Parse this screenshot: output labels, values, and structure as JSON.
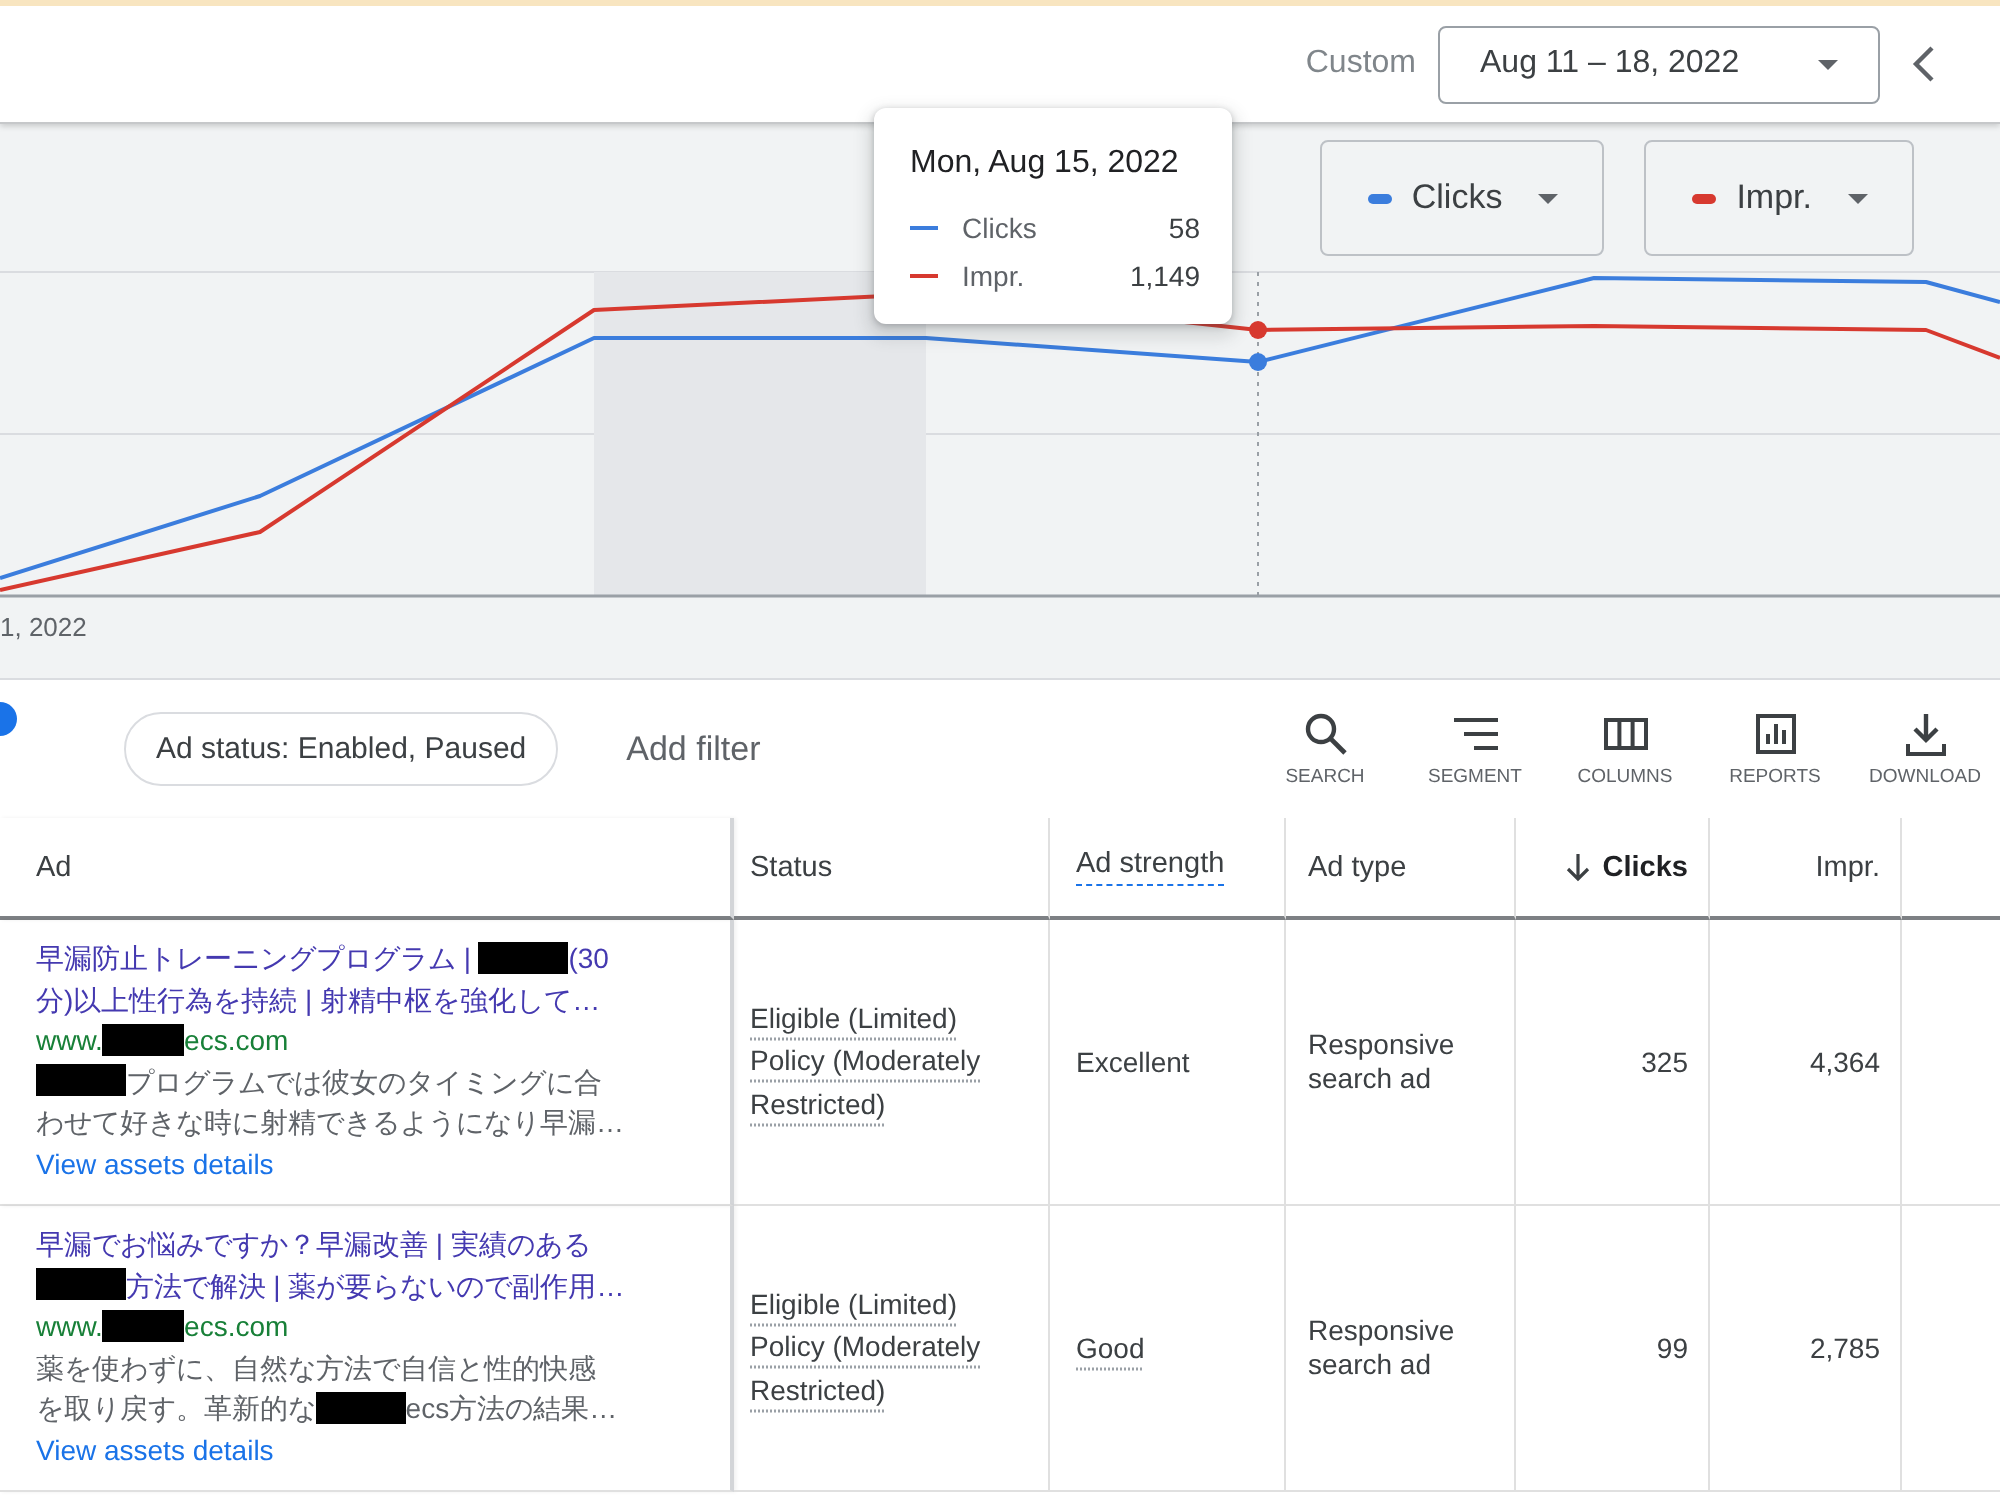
{
  "header": {
    "range_label": "Custom",
    "date_range": "Aug 11 – 18, 2022"
  },
  "chart": {
    "metrics": [
      {
        "label": "Clicks",
        "color": "#3b7ddd"
      },
      {
        "label": "Impr.",
        "color": "#d7392f"
      }
    ],
    "x_label": "1, 2022",
    "tooltip": {
      "title": "Mon, Aug 15, 2022",
      "rows": [
        {
          "label": "Clicks",
          "value": "58"
        },
        {
          "label": "Impr.",
          "value": "1,149"
        }
      ]
    }
  },
  "filter_bar": {
    "filters": [
      {
        "label": "Ad status: Enabled, Paused"
      }
    ],
    "add_filter": "Add filter",
    "tools": [
      {
        "kind": "search",
        "label": "SEARCH"
      },
      {
        "kind": "segment",
        "label": "SEGMENT"
      },
      {
        "kind": "columns",
        "label": "COLUMNS"
      },
      {
        "kind": "reports",
        "label": "REPORTS"
      },
      {
        "kind": "download",
        "label": "DOWNLOAD"
      }
    ]
  },
  "table": {
    "columns": [
      {
        "label": "Ad",
        "kind": "text",
        "sorted": false,
        "hint": false
      },
      {
        "label": "Status",
        "kind": "text",
        "sorted": false,
        "hint": false
      },
      {
        "label": "Ad strength",
        "kind": "text",
        "sorted": false,
        "hint": true
      },
      {
        "label": "Ad type",
        "kind": "text",
        "sorted": false,
        "hint": false
      },
      {
        "label": "Clicks",
        "kind": "number",
        "sorted": true,
        "hint": false
      },
      {
        "label": "Impr.",
        "kind": "number",
        "sorted": false,
        "hint": false
      }
    ],
    "rows": [
      {
        "ad": {
          "headline": [
            {
              "kind": "text",
              "text": "早漏防止トレーニングプログラム | "
            },
            {
              "kind": "redaction"
            },
            {
              "kind": "text",
              "text": "(30"
            },
            {
              "kind": "break"
            },
            {
              "kind": "text",
              "text": "分)以上性行為を持続 | 射精中枢を強化して…"
            }
          ],
          "url": [
            {
              "kind": "text",
              "text": "www."
            },
            {
              "kind": "redaction"
            },
            {
              "kind": "text",
              "text": "ecs.com"
            }
          ],
          "description": [
            {
              "kind": "redaction"
            },
            {
              "kind": "text",
              "text": "プログラムでは彼女のタイミングに合"
            },
            {
              "kind": "break"
            },
            {
              "kind": "text",
              "text": "わせて好きな時に射精できるようになり早漏…"
            }
          ],
          "link": "View assets details"
        },
        "status": "Eligible (Limited) Policy (Moderately Restricted)",
        "ad_strength": {
          "text": "Excellent",
          "hint": false
        },
        "ad_type": "Responsive search ad",
        "clicks": "325",
        "impr": "4,364"
      },
      {
        "ad": {
          "headline": [
            {
              "kind": "text",
              "text": "早漏でお悩みですか？早漏改善 | 実績のある"
            },
            {
              "kind": "break"
            },
            {
              "kind": "redaction"
            },
            {
              "kind": "text",
              "text": "方法で解決 | 薬が要らないので副作用…"
            }
          ],
          "url": [
            {
              "kind": "text",
              "text": "www."
            },
            {
              "kind": "redaction"
            },
            {
              "kind": "text",
              "text": "ecs.com"
            }
          ],
          "description": [
            {
              "kind": "text",
              "text": "薬を使わずに、自然な方法で自信と性的快感"
            },
            {
              "kind": "break"
            },
            {
              "kind": "text",
              "text": "を取り戻す。革新的な"
            },
            {
              "kind": "redaction"
            },
            {
              "kind": "text",
              "text": "ecs方法の結果…"
            }
          ],
          "link": "View assets details"
        },
        "status": "Eligible (Limited) Policy (Moderately Restricted)",
        "ad_strength": {
          "text": "Good",
          "hint": true
        },
        "ad_type": "Responsive search ad",
        "clicks": "99",
        "impr": "2,785"
      }
    ]
  }
}
